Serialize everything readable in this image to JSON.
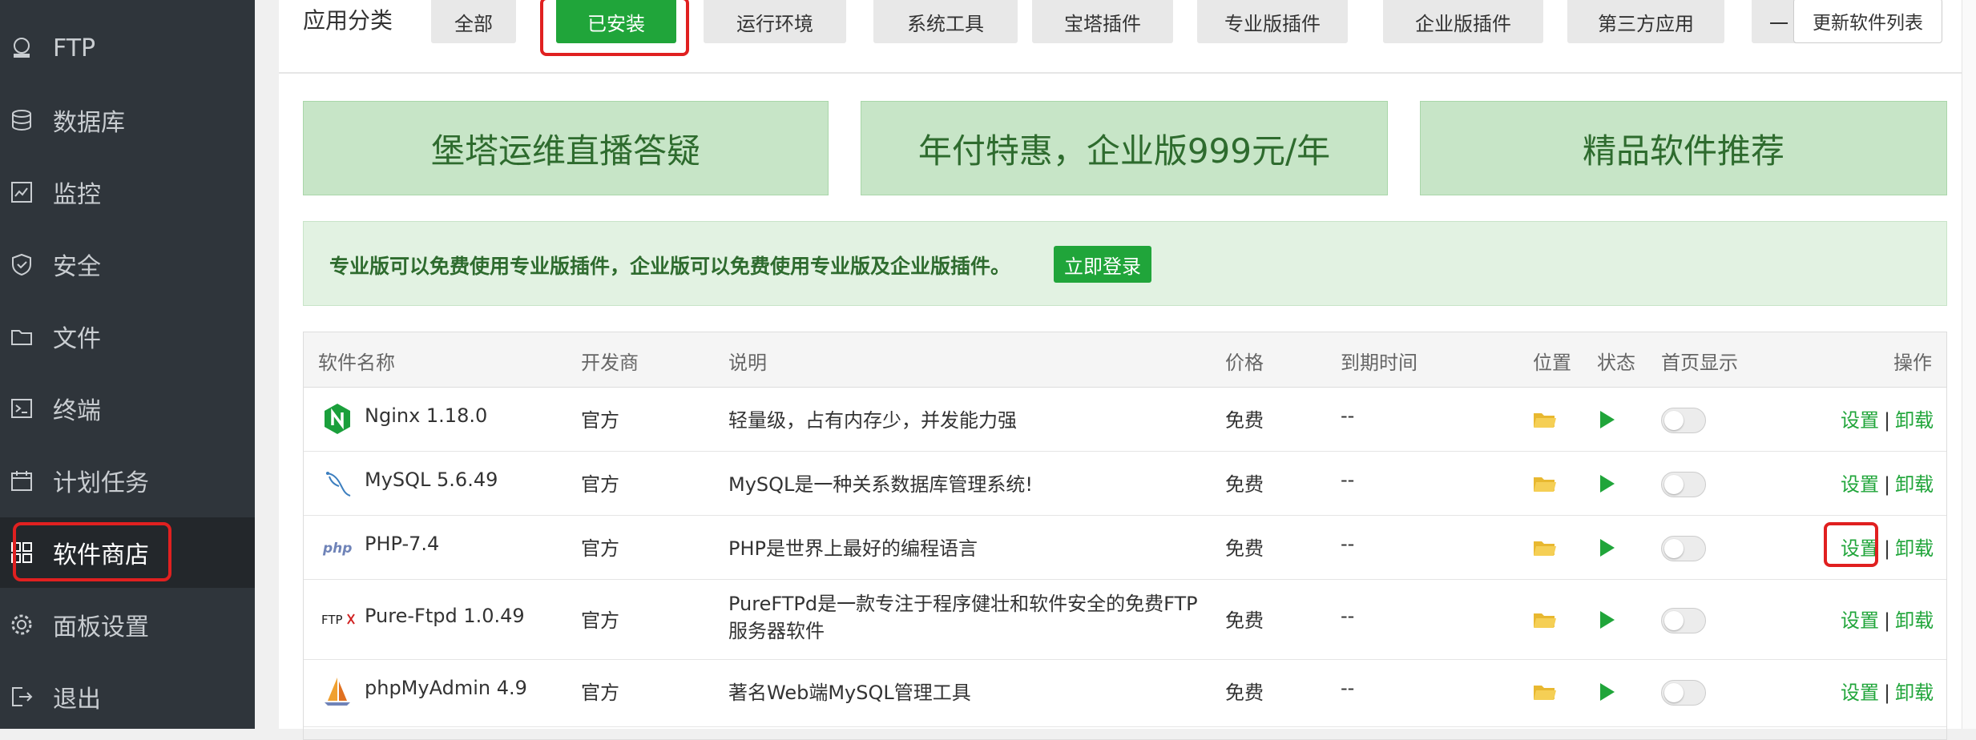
{
  "sidebar": {
    "items": [
      {
        "label": "FTP",
        "icon": "ftp-icon"
      },
      {
        "label": "数据库",
        "icon": "database-icon"
      },
      {
        "label": "监控",
        "icon": "monitor-icon"
      },
      {
        "label": "安全",
        "icon": "shield-icon"
      },
      {
        "label": "文件",
        "icon": "folder-icon"
      },
      {
        "label": "终端",
        "icon": "terminal-icon"
      },
      {
        "label": "计划任务",
        "icon": "calendar-icon"
      },
      {
        "label": "软件商店",
        "icon": "grid-icon"
      },
      {
        "label": "面板设置",
        "icon": "gear-icon"
      },
      {
        "label": "退出",
        "icon": "logout-icon"
      }
    ],
    "active_index": 7
  },
  "categories": {
    "label": "应用分类",
    "tabs": [
      "全部",
      "已安装",
      "运行环境",
      "系统工具",
      "宝塔插件",
      "专业版插件",
      "企业版插件",
      "第三方应用",
      "一"
    ],
    "active": "已安装",
    "update_button": "更新软件列表"
  },
  "promos": [
    "堡塔运维直播答疑",
    "年付特惠，企业版999元/年",
    "精品软件推荐"
  ],
  "notice": {
    "text": "专业版可以免费使用专业版插件，企业版可以免费使用专业版及企业版插件。",
    "button": "立即登录"
  },
  "table": {
    "headers": {
      "name": "软件名称",
      "developer": "开发商",
      "description": "说明",
      "price": "价格",
      "expiry": "到期时间",
      "location": "位置",
      "status": "状态",
      "homepage": "首页显示",
      "actions": "操作"
    },
    "rows": [
      {
        "name": "Nginx 1.18.0",
        "developer": "官方",
        "description": "轻量级，占有内存少，并发能力强",
        "price": "免费",
        "expiry": "--",
        "icon": "nginx-icon"
      },
      {
        "name": "MySQL 5.6.49",
        "developer": "官方",
        "description": "MySQL是一种关系数据库管理系统!",
        "price": "免费",
        "expiry": "--",
        "icon": "mysql-icon"
      },
      {
        "name": "PHP-7.4",
        "developer": "官方",
        "description": "PHP是世界上最好的编程语言",
        "price": "免费",
        "expiry": "--",
        "icon": "php-icon"
      },
      {
        "name": "Pure-Ftpd 1.0.49",
        "developer": "官方",
        "description": "PureFTPd是一款专注于程序健壮和软件安全的免费FTP服务器软件",
        "price": "免费",
        "expiry": "--",
        "icon": "pureftpd-icon"
      },
      {
        "name": "phpMyAdmin 4.9",
        "developer": "官方",
        "description": "著名Web端MySQL管理工具",
        "price": "免费",
        "expiry": "--",
        "icon": "phpmyadmin-icon"
      }
    ],
    "action_settings": "设置",
    "action_separator": "|",
    "action_uninstall": "卸载"
  },
  "colors": {
    "accent": "#20a53a",
    "sidebar_bg": "#2f353b",
    "highlight": "#e02020"
  }
}
